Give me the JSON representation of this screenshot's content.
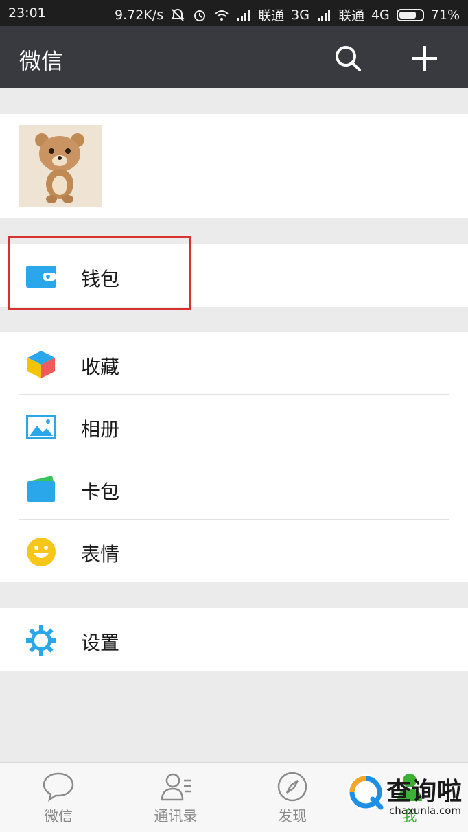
{
  "status_bar": {
    "time": "23:01",
    "speed": "9.72K/s",
    "carrier1": "联通",
    "network1": "3G",
    "carrier2": "联通",
    "network2": "4G",
    "battery": "71%"
  },
  "header": {
    "title": "微信",
    "search_icon": "search-icon",
    "add_icon": "plus-icon"
  },
  "profile": {
    "avatar": "teddy-bear-avatar"
  },
  "menu": {
    "wallet": {
      "label": "钱包",
      "icon": "wallet-icon",
      "highlighted": true
    },
    "group2": [
      {
        "label": "收藏",
        "icon": "favorites-cube-icon"
      },
      {
        "label": "相册",
        "icon": "album-picture-icon"
      },
      {
        "label": "卡包",
        "icon": "card-package-icon"
      },
      {
        "label": "表情",
        "icon": "smiley-icon"
      }
    ],
    "settings": {
      "label": "设置",
      "icon": "gear-icon"
    }
  },
  "tabs": [
    {
      "label": "微信",
      "icon": "chat-bubble-icon"
    },
    {
      "label": "通讯录",
      "icon": "contacts-icon"
    },
    {
      "label": "发现",
      "icon": "compass-icon"
    },
    {
      "label": "我",
      "icon": "person-icon"
    }
  ],
  "watermark": {
    "title": "查询啦",
    "subtitle": "chaxunla.com"
  },
  "colors": {
    "header_bg": "#393a3f",
    "status_bg": "#1e1e1e",
    "page_bg": "#ebebeb",
    "highlight_red": "#d6322f",
    "icon_blue": "#2aa7ea"
  }
}
